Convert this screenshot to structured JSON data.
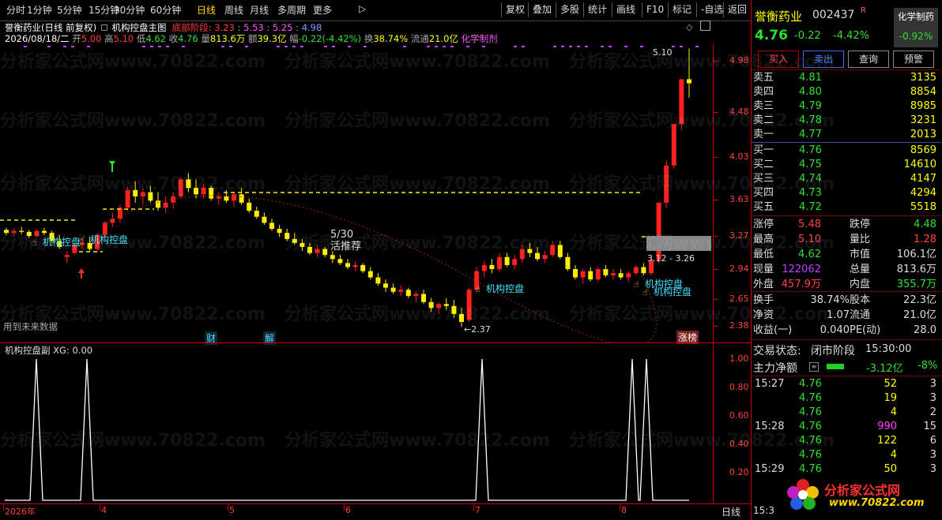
{
  "toolbar": {
    "periods": [
      "分时",
      "1分钟",
      "5分钟",
      "15分钟",
      "30分钟",
      "60分钟",
      "日线",
      "周线",
      "月线",
      "多周期",
      "更多"
    ],
    "active_period": "日线",
    "right_buttons": [
      "复权",
      "叠加",
      "多股",
      "统计",
      "画线",
      "F10",
      "标记",
      "-自选",
      "返回"
    ]
  },
  "chart": {
    "title": "誉衡药业(日线 前复权)",
    "indicator_name": "机构控盘主图",
    "stage_label": "底部阶段:",
    "stage_values": [
      "3.23",
      "5.53",
      "5.25",
      "4.98"
    ],
    "date": "2026/08/18/二",
    "open_label": "开",
    "open": "5.00",
    "high_label": "高",
    "high": "5.10",
    "low_label": "低",
    "low": "4.62",
    "close_label": "收",
    "close": "4.76",
    "vol_label": "量",
    "vol": "813.6万",
    "amount_label": "额",
    "amount": "39.3亿",
    "change_label": "幅",
    "change": "-0.22(-4.42%)",
    "turnover_label": "换",
    "turnover": "38.74%",
    "float_label": "流通",
    "float": "21.0亿",
    "sector": "化学制剂",
    "y_ticks": [
      "4.98",
      "4.48",
      "4.03",
      "3.63",
      "3.27",
      "2.94",
      "2.65",
      "2.38"
    ],
    "annotations": {
      "high_mark": "5.10",
      "low_mark": "2.37",
      "range_mark": "3.12 - 3.26",
      "event_date": "5/30",
      "event_text": "活推荐",
      "future_note": "用到未来数据",
      "fin_tag": "财",
      "lift_tag": "解",
      "limit_tag": "涨榜",
      "signal_label": "机构控盘"
    },
    "x_labels": [
      "2026年",
      "4",
      "5",
      "6",
      "7",
      "8"
    ],
    "period_label": "日线"
  },
  "sub_chart": {
    "title": "机构控盘副 XG: 0.00",
    "y_ticks": [
      "1.00",
      "0.80",
      "0.60",
      "0.40",
      "0.20"
    ]
  },
  "watermark": "分析家公式网www.70822.com",
  "quote": {
    "name": "誉衡药业",
    "code": "002437",
    "r_mark": "R",
    "sector_badge": "化学制药",
    "sector_change": "-0.92%",
    "price": "4.76",
    "change": "-0.22",
    "change_pct": "-4.42%",
    "buttons": [
      "买入",
      "卖出",
      "查询",
      "预警"
    ],
    "asks": [
      {
        "label": "卖五",
        "price": "4.81",
        "vol": "3135"
      },
      {
        "label": "卖四",
        "price": "4.80",
        "vol": "8854"
      },
      {
        "label": "卖三",
        "price": "4.79",
        "vol": "8985"
      },
      {
        "label": "卖二",
        "price": "4.78",
        "vol": "3231"
      },
      {
        "label": "卖一",
        "price": "4.77",
        "vol": "2013"
      }
    ],
    "bids": [
      {
        "label": "买一",
        "price": "4.76",
        "vol": "8569"
      },
      {
        "label": "买二",
        "price": "4.75",
        "vol": "14610"
      },
      {
        "label": "买三",
        "price": "4.74",
        "vol": "4147"
      },
      {
        "label": "买四",
        "price": "4.73",
        "vol": "4294"
      },
      {
        "label": "买五",
        "price": "4.72",
        "vol": "5518"
      }
    ],
    "stats": [
      {
        "l1": "涨停",
        "v1": "5.48",
        "l2": "跌停",
        "v2": "4.48"
      },
      {
        "l1": "最高",
        "v1": "5.10",
        "l2": "量比",
        "v2": "1.28"
      },
      {
        "l1": "最低",
        "v1": "4.62",
        "l2": "市值",
        "v2": "106.1亿"
      },
      {
        "l1": "现量",
        "v1": "122062",
        "l2": "总量",
        "v2": "813.6万"
      },
      {
        "l1": "外盘",
        "v1": "457.9万",
        "l2": "内盘",
        "v2": "355.7万"
      }
    ],
    "stats2": [
      {
        "l1": "换手",
        "v1": "38.74%",
        "l2": "股本",
        "v2": "22.3亿"
      },
      {
        "l1": "净资",
        "v1": "1.07",
        "l2": "流通",
        "v2": "21.0亿"
      },
      {
        "l1": "收益(一)",
        "v1": "0.040",
        "l2": "PE(动)",
        "v2": "28.0"
      }
    ],
    "trade_state_label": "交易状态:",
    "trade_state": "闭市阶段",
    "trade_time": "15:30:00",
    "net_flow_label": "主力净额",
    "net_flow": "-3.12亿",
    "net_flow_pct": "-8%",
    "ticks": [
      {
        "time": "15:27",
        "price": "4.76",
        "vol": "52",
        "n": "3"
      },
      {
        "time": "",
        "price": "4.76",
        "vol": "19",
        "n": "3"
      },
      {
        "time": "",
        "price": "4.76",
        "vol": "4",
        "n": "2"
      },
      {
        "time": "15:28",
        "price": "4.76",
        "vol": "990",
        "n": "15"
      },
      {
        "time": "",
        "price": "4.76",
        "vol": "122",
        "n": "6"
      },
      {
        "time": "",
        "price": "4.76",
        "vol": "4",
        "n": "3"
      },
      {
        "time": "15:29",
        "price": "4.76",
        "vol": "50",
        "n": "3"
      }
    ],
    "last_tick_time": "15:3",
    "logo_text": "分析家公式网",
    "logo_url": "www.70822.com"
  }
}
